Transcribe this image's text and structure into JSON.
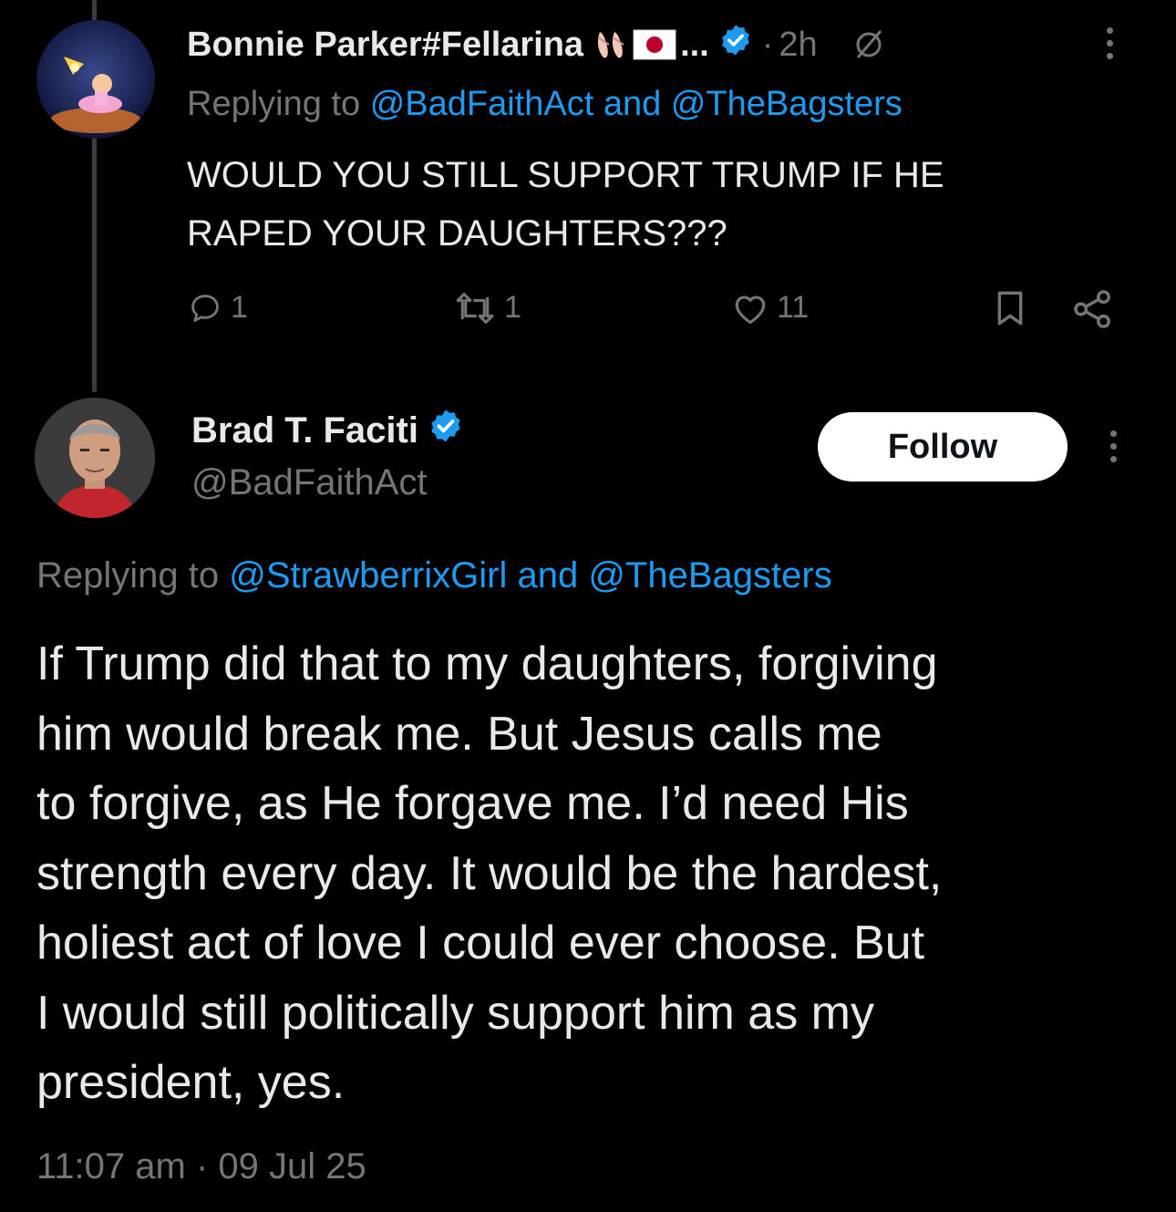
{
  "reply_tweet": {
    "display_name": "Bonnie Parker#Fellarina",
    "name_truncation": "...",
    "separator": "·",
    "time_ago": "2h",
    "replying_prefix": "Replying to",
    "replying_user1": "@BadFaithAct",
    "replying_and": "and",
    "replying_user2": "@TheBagsters",
    "text_line1": "WOULD YOU STILL SUPPORT TRUMP IF HE",
    "text_line2": "RAPED YOUR DAUGHTERS???",
    "reply_count": "1",
    "repost_count": "1",
    "like_count": "11"
  },
  "main_tweet": {
    "display_name": "Brad T. Faciti",
    "handle": "@BadFaithAct",
    "follow_label": "Follow",
    "replying_prefix": "Replying to",
    "replying_user1": "@StrawberrixGirl",
    "replying_and": "and",
    "replying_user2": "@TheBagsters",
    "lines": [
      "If Trump did that to my daughters, forgiving",
      "him would break me. But Jesus calls me",
      "to forgive, as He forgave me. I’d need His",
      "strength every day. It would be the hardest,",
      "holiest act of love I could ever choose. But",
      "I would still politically support him as my",
      "president, yes."
    ],
    "time": "11:07 am",
    "separator": "·",
    "date": "09 Jul 25"
  },
  "colors": {
    "background": "#000000",
    "text": "#e7e9ea",
    "muted": "#71767b",
    "link": "#1d9bf0",
    "verified": "#1d9bf0"
  }
}
